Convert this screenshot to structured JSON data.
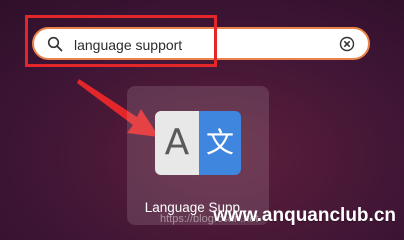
{
  "search": {
    "value": "language support",
    "search_icon": "search-icon",
    "clear_icon": "clear-icon"
  },
  "app_result": {
    "label": "Language Supp...",
    "icon_name": "language-support-icon",
    "icon_left_glyph": "A",
    "icon_right_glyph": "文"
  },
  "annotation": {
    "box_color": "#e2262a",
    "arrow_color": "#e2262a"
  },
  "watermark": {
    "text": "www.anquanclub.cn",
    "underlying_text": "https://blog.csdn.net"
  },
  "colors": {
    "search_border": "#e9834b",
    "icon_blue": "#3f86df",
    "background": "#3f1535"
  }
}
